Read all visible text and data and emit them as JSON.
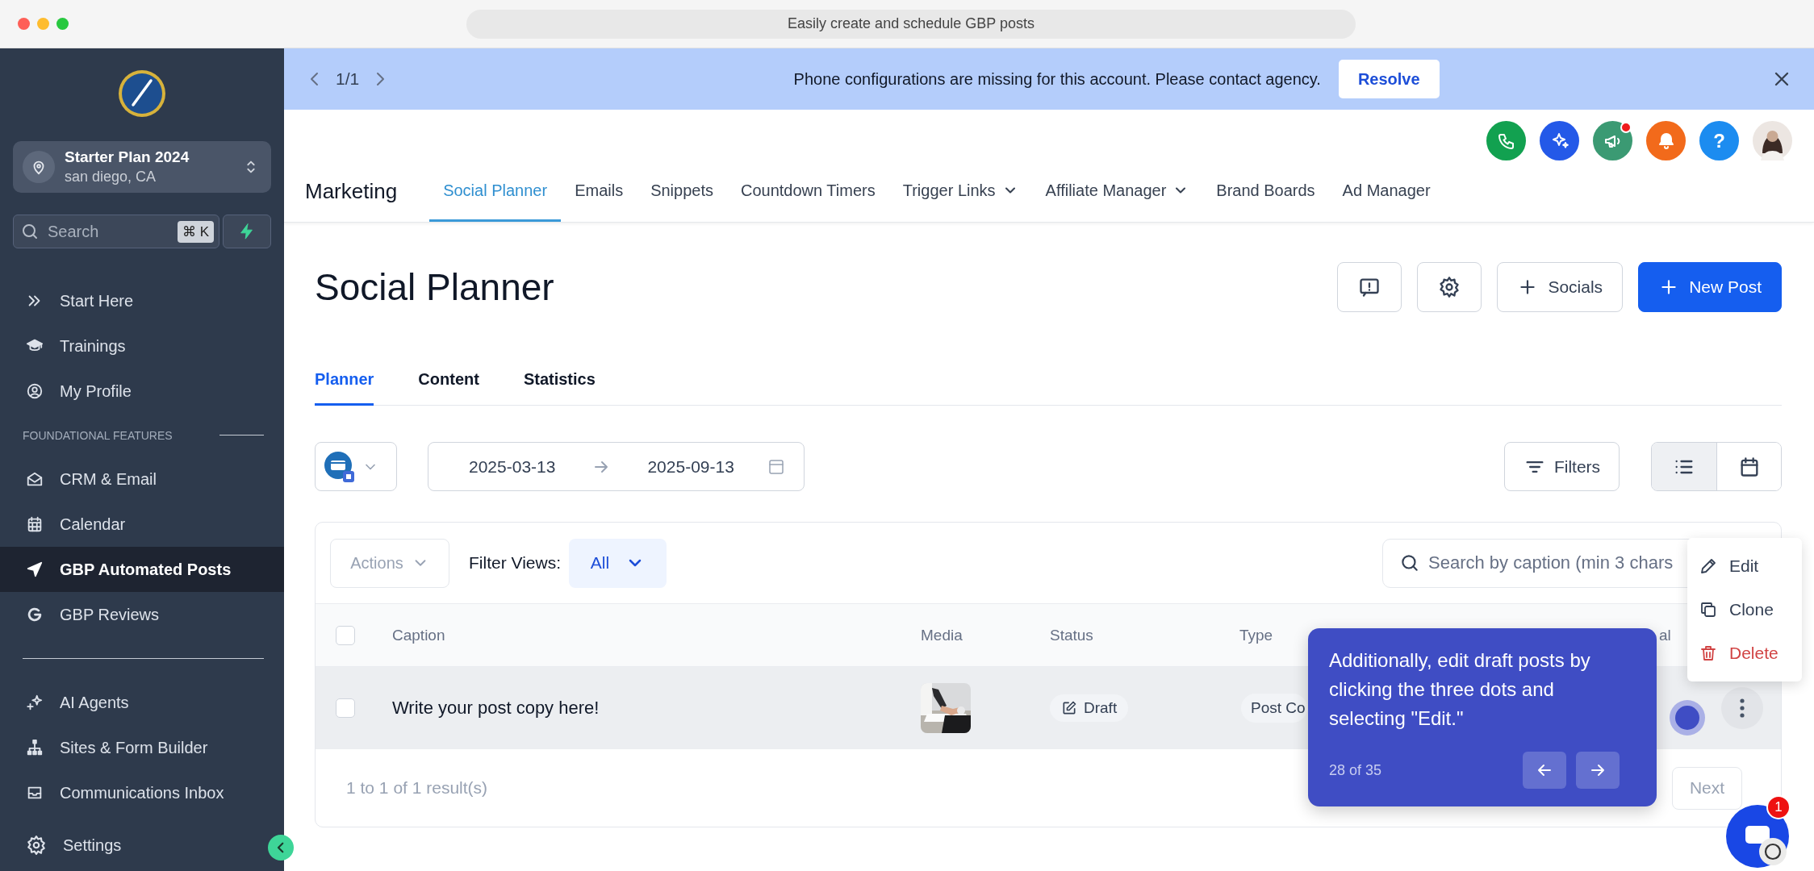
{
  "browser": {
    "title": "Easily create and schedule GBP posts"
  },
  "sidebar": {
    "account": {
      "name": "Starter Plan 2024",
      "location": "san diego, CA"
    },
    "search": {
      "placeholder": "Search",
      "shortcut": "⌘ K"
    },
    "groups": [
      {
        "items": [
          {
            "label": "Start Here",
            "selected": false
          },
          {
            "label": "Trainings",
            "selected": false
          },
          {
            "label": "My Profile",
            "selected": false
          }
        ]
      },
      {
        "heading": "FOUNDATIONAL FEATURES",
        "items": [
          {
            "label": "CRM & Email",
            "selected": false
          },
          {
            "label": "Calendar",
            "selected": false
          },
          {
            "label": "GBP Automated Posts",
            "selected": true
          },
          {
            "label": "GBP Reviews",
            "selected": false
          }
        ]
      },
      {
        "items": [
          {
            "label": "AI Agents",
            "selected": false
          },
          {
            "label": "Sites & Form Builder",
            "selected": false
          },
          {
            "label": "Communications Inbox",
            "selected": false
          }
        ]
      }
    ],
    "footer_item": {
      "label": "Settings",
      "selected": false
    }
  },
  "banner": {
    "pager": "1/1",
    "message": "Phone configurations are missing for this account. Please contact agency.",
    "action": "Resolve"
  },
  "header": {
    "actions": [
      {
        "color": "#12a150",
        "dot": false
      },
      {
        "color": "#2459e8",
        "dot": false
      },
      {
        "color": "#3b9a73",
        "dot": true
      },
      {
        "color": "#f26a1b",
        "dot": false
      },
      {
        "color": "#1c8cf0",
        "dot": false,
        "label": "?"
      }
    ],
    "title": "Marketing",
    "tabs": [
      {
        "label": "Social Planner",
        "selected": true,
        "dropdown": false
      },
      {
        "label": "Emails",
        "selected": false,
        "dropdown": false
      },
      {
        "label": "Snippets",
        "selected": false,
        "dropdown": false
      },
      {
        "label": "Countdown Timers",
        "selected": false,
        "dropdown": false
      },
      {
        "label": "Trigger Links",
        "selected": false,
        "dropdown": true
      },
      {
        "label": "Affiliate Manager",
        "selected": false,
        "dropdown": true
      },
      {
        "label": "Brand Boards",
        "selected": false,
        "dropdown": false
      },
      {
        "label": "Ad Manager",
        "selected": false,
        "dropdown": false
      }
    ]
  },
  "page": {
    "title": "Social Planner",
    "buttons": [
      {
        "label": "Socials",
        "kind": "secondary"
      },
      {
        "label": "New Post",
        "kind": "primary"
      }
    ],
    "tabs": [
      {
        "label": "Planner",
        "selected": true
      },
      {
        "label": "Content",
        "selected": false
      },
      {
        "label": "Statistics",
        "selected": false
      }
    ]
  },
  "filters": {
    "date_start": "2025-03-13",
    "date_end": "2025-09-13",
    "filters_button": "Filters",
    "views": [
      {
        "selected": true
      },
      {
        "selected": false
      }
    ]
  },
  "table": {
    "actions_button": "Actions",
    "filter_views": {
      "label": "Filter Views:",
      "value": "All"
    },
    "search": {
      "placeholder": "Search by caption (min 3 chars"
    },
    "select_all": {
      "checked": false
    },
    "columns": [
      "Caption",
      "Media",
      "Status",
      "Type",
      "al"
    ],
    "rows": [
      {
        "checked": false,
        "caption": "Write your post copy here!",
        "status": "Draft",
        "type": "Post Co"
      }
    ],
    "summary": "1 to 1 of 1 result(s)",
    "next_button": "Next"
  },
  "row_menu": {
    "items": [
      {
        "label": "Edit",
        "kind": "normal"
      },
      {
        "label": "Clone",
        "kind": "normal"
      },
      {
        "label": "Delete",
        "kind": "danger"
      }
    ]
  },
  "tour": {
    "text": "Additionally, edit draft posts by clicking the three dots and selecting \"Edit.\"",
    "step": "28 of 35"
  },
  "chat": {
    "badge": "1"
  }
}
